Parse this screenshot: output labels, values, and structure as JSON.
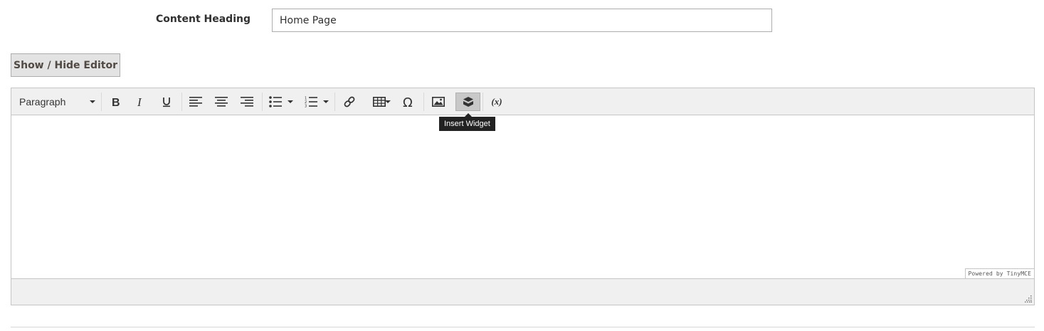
{
  "form": {
    "content_heading_label": "Content Heading",
    "content_heading_value": "Home Page"
  },
  "editor_toggle": {
    "label": "Show / Hide Editor"
  },
  "editor": {
    "format_select": "Paragraph",
    "toolbar": {
      "tooltip": "Insert Widget",
      "variable_label": "(x)"
    },
    "branding": "Powered by TinyMCE"
  }
}
